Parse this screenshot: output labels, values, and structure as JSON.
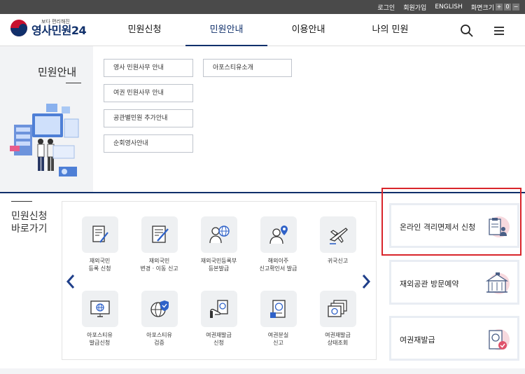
{
  "topbar": {
    "login": "로그인",
    "signup": "회원가입",
    "english": "ENGLISH",
    "font_size_label": "화면크기",
    "font_size_buttons": [
      "+",
      "0",
      "−"
    ]
  },
  "logo": {
    "small": "보다 편리해진",
    "big": "영사민원24"
  },
  "nav": {
    "items": [
      "민원신청",
      "민원안내",
      "이용안내",
      "나의 민원"
    ],
    "active": "민원안내"
  },
  "dropdown": {
    "title": "민원안내",
    "links": [
      "영사 민원사무 안내",
      "여권 민원사무 안내",
      "공관별민원 추가안내",
      "순회영사안내",
      "아포스티유소개"
    ]
  },
  "shortcut": {
    "title": "민원신청\n바로가기",
    "tiles": [
      {
        "label": "재외국민\n등록 신청",
        "icon": "document-pen-icon"
      },
      {
        "label": "재외국민\n변경 · 이동 신고",
        "icon": "edit-document-icon"
      },
      {
        "label": "재외국민등록부\n등본발급",
        "icon": "person-globe-icon"
      },
      {
        "label": "해외이주\n신고확인서 발급",
        "icon": "person-location-icon"
      },
      {
        "label": "귀국신고",
        "icon": "airplane-icon"
      },
      {
        "label": "아포스티유\n발급신청",
        "icon": "monitor-globe-icon"
      },
      {
        "label": "아포스티유\n검증",
        "icon": "globe-shield-icon"
      },
      {
        "label": "여권재발급\n신청",
        "icon": "hand-passport-icon"
      },
      {
        "label": "여권분실\n신고",
        "icon": "passport-icon"
      },
      {
        "label": "여권재발급\n상태조회",
        "icon": "passport-stack-icon"
      }
    ]
  },
  "cards": [
    {
      "label": "온라인 격리면제서 신청",
      "icon": "clipboard-person-icon"
    },
    {
      "label": "재외공관 방문예약",
      "icon": "embassy-building-icon"
    },
    {
      "label": "여권재발급",
      "icon": "passport-check-icon"
    }
  ],
  "colors": {
    "brand": "#10306b",
    "highlight": "#d9252b",
    "topbar": "#4a4a4a"
  }
}
